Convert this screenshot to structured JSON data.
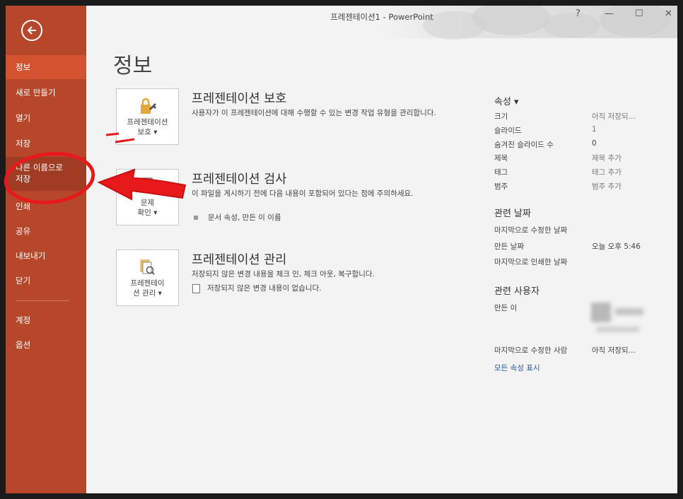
{
  "window": {
    "title": "프레젠테이션1 - PowerPoint",
    "controls": {
      "help": "?",
      "minimize": "—",
      "maximize": "☐",
      "close": "✕"
    }
  },
  "sidebar": {
    "items": [
      {
        "label": "정보",
        "state": "active"
      },
      {
        "label": "새로 만들기"
      },
      {
        "label": "열기"
      },
      {
        "label": "저장"
      },
      {
        "label": "다른 이름으로\n저장",
        "state": "hover"
      },
      {
        "label": "인쇄"
      },
      {
        "label": "공유"
      },
      {
        "label": "내보내기"
      },
      {
        "label": "닫기"
      },
      {
        "label": "계정"
      },
      {
        "label": "옵션"
      }
    ]
  },
  "main": {
    "title": "정보",
    "sections": [
      {
        "button_label": "프레젠테이션\n보호 ▾",
        "title": "프레젠테이션 보호",
        "description": "사용자가 이 프레젠테이션에 대해 수행할 수 있는 변경 작업 유형을 관리합니다.",
        "icon": "lock-key-icon"
      },
      {
        "button_label": "문제\n확인 ▾",
        "title": "프레젠테이션 검사",
        "description": "이 파일을 게시하기 전에 다음 내용이 포함되어 있다는 점에 주의하세요.",
        "bullet": "문서 속성, 만든 이 이름",
        "icon": "inspect-document-icon"
      },
      {
        "button_label": "프레젠테이\n션 관리 ▾",
        "title": "프레젠테이션 관리",
        "description": "저장되지 않은 변경 내용을 체크 인, 체크 아웃, 복구합니다.",
        "bullet": "저장되지 않은 변경 내용이 없습니다.",
        "icon": "manage-versions-icon"
      }
    ]
  },
  "properties": {
    "header": "속성 ▾",
    "rows": [
      {
        "label": "크기",
        "value": "아직 저장되..."
      },
      {
        "label": "슬라이드",
        "value": "1"
      },
      {
        "label": "숨겨진 슬라이드 수",
        "value": "0"
      },
      {
        "label": "제목",
        "value": "제목 추가"
      },
      {
        "label": "태그",
        "value": "태그 추가"
      },
      {
        "label": "범주",
        "value": "범주 추가"
      }
    ],
    "dates_header": "관련 날짜",
    "dates": [
      {
        "label": "마지막으로 수정한 날짜",
        "value": ""
      },
      {
        "label": "만든 날짜",
        "value": "오늘 오후 5:46"
      },
      {
        "label": "마지막으로 인쇄한 날짜",
        "value": ""
      }
    ],
    "people_header": "관련 사용자",
    "author_label": "만든 이",
    "last_modified_by_label": "마지막으로 수정한 사람",
    "last_modified_by_value": "아직 저장되...",
    "show_all": "모든 속성 표시"
  },
  "colors": {
    "sidebar": "#b7472a",
    "sidebar_active": "#d35230",
    "annotation": "#e8191a",
    "link": "#2b579a"
  }
}
